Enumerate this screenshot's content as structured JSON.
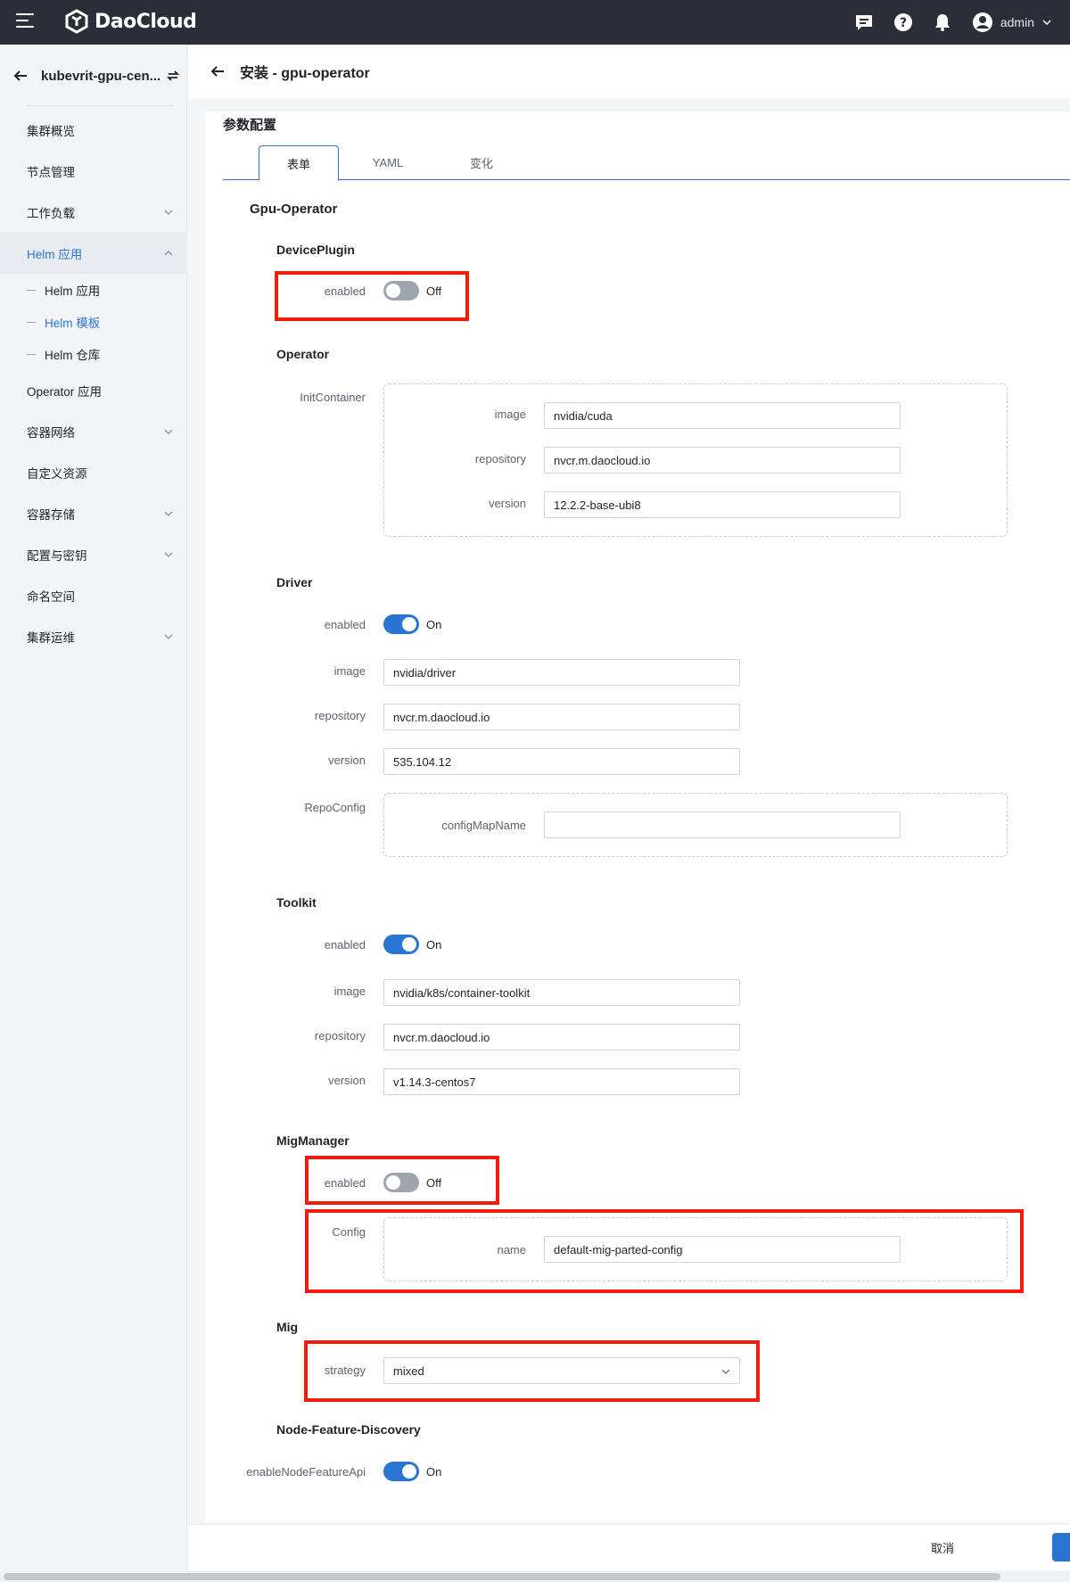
{
  "topbar": {
    "brand": "DaoCloud",
    "user": "admin",
    "icons": [
      "menu-icon",
      "message-icon",
      "help-icon",
      "bell-icon",
      "user-avatar-icon",
      "chevron-down-icon"
    ]
  },
  "sidebar": {
    "cluster_name": "kubevrit-gpu-cen...",
    "items": [
      {
        "label": "集群概览"
      },
      {
        "label": "节点管理"
      },
      {
        "label": "工作负载"
      },
      {
        "label": "Helm 应用"
      },
      {
        "label": "Operator 应用"
      },
      {
        "label": "容器网络"
      },
      {
        "label": "自定义资源"
      },
      {
        "label": "容器存储"
      },
      {
        "label": "配置与密钥"
      },
      {
        "label": "命名空间"
      },
      {
        "label": "集群运维"
      }
    ],
    "helm_sub": [
      {
        "label": "Helm 应用"
      },
      {
        "label": "Helm 模板"
      },
      {
        "label": "Helm 仓库"
      }
    ]
  },
  "page": {
    "title": "安装 - gpu-operator",
    "section_title": "参数配置",
    "tabs": [
      {
        "label": "表单"
      },
      {
        "label": "YAML"
      },
      {
        "label": "变化"
      }
    ]
  },
  "form": {
    "main_title": "Gpu-Operator",
    "device_plugin": {
      "title": "DevicePlugin",
      "enabled_label": "enabled",
      "state": "Off"
    },
    "operator": {
      "title": "Operator",
      "init_label": "InitContainer",
      "image_label": "image",
      "image": "nvidia/cuda",
      "repo_label": "repository",
      "repo": "nvcr.m.daocloud.io",
      "version_label": "version",
      "version": "12.2.2-base-ubi8"
    },
    "driver": {
      "title": "Driver",
      "enabled_label": "enabled",
      "state": "On",
      "image_label": "image",
      "image": "nvidia/driver",
      "repo_label": "repository",
      "repo": "nvcr.m.daocloud.io",
      "version_label": "version",
      "version": "535.104.12",
      "repo_config_label": "RepoConfig",
      "config_map_label": "configMapName",
      "config_map": ""
    },
    "toolkit": {
      "title": "Toolkit",
      "enabled_label": "enabled",
      "state": "On",
      "image_label": "image",
      "image": "nvidia/k8s/container-toolkit",
      "repo_label": "repository",
      "repo": "nvcr.m.daocloud.io",
      "version_label": "version",
      "version": "v1.14.3-centos7"
    },
    "mig_manager": {
      "title": "MigManager",
      "enabled_label": "enabled",
      "state": "Off",
      "config_label": "Config",
      "name_label": "name",
      "name": "default-mig-parted-config"
    },
    "mig": {
      "title": "Mig",
      "strategy_label": "strategy",
      "strategy": "mixed"
    },
    "nfd": {
      "title": "Node-Feature-Discovery",
      "api_label": "enableNodeFeatureApi",
      "state": "On"
    }
  },
  "footer": {
    "cancel": "取消"
  },
  "colors": {
    "accent": "#2a75d4",
    "highlight": "#f21c0c",
    "topbar": "#2b2e36"
  }
}
